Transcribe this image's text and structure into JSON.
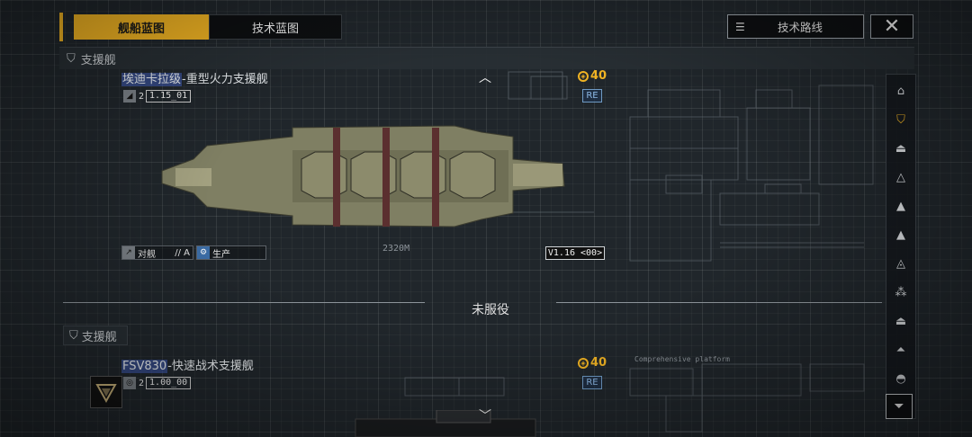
{
  "tabs": [
    {
      "label": "舰船蓝图",
      "active": true
    },
    {
      "label": "技术蓝图",
      "active": false
    }
  ],
  "tech_route_label": "技术路线",
  "close_glyph": "✕",
  "section_title": "支援舰",
  "ships": [
    {
      "name_highlight": "埃迪卡拉级",
      "name_rest": "-重型火力支援舰",
      "tier": "2",
      "code": "1.15_01",
      "cost": "40",
      "badge": "RE",
      "role_label": "对舰",
      "role_code": "// A",
      "prod_label": "生产",
      "length": "2320M",
      "version": "V1.16 <00>"
    },
    {
      "name_highlight": "FSV830",
      "name_rest": "-快速战术支援舰",
      "tier": "2",
      "code": "1.00_00",
      "cost": "40",
      "badge": "RE"
    }
  ],
  "divider_label": "未服役",
  "section_title_2": "支援舰",
  "blueprint_caption": "Comprehensive platform",
  "sidebar_icons": [
    "hangar-icon",
    "support-ship-icon",
    "carrier-icon",
    "frigate-icon",
    "destroyer-icon",
    "cruiser-icon",
    "battlecruiser-icon",
    "aircraft-icon",
    "base-icon",
    "platform-icon",
    "corvette-icon"
  ],
  "colors": {
    "accent": "#f0b323",
    "badge": "#8cb8e6",
    "background": "#20262b"
  }
}
